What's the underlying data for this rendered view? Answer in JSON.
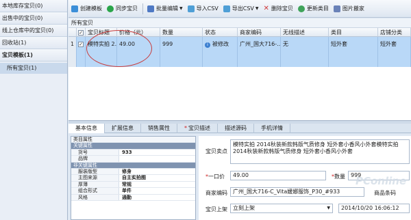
{
  "sidebar": {
    "items": [
      {
        "label": "本地库存宝贝(0)"
      },
      {
        "label": "出售中的宝贝(0)"
      },
      {
        "label": "线上仓库中的宝贝(0)"
      },
      {
        "label": "回收站(1)"
      },
      {
        "label": "宝贝模板(1)"
      }
    ],
    "sub_item": {
      "label": "所有宝贝(1)"
    }
  },
  "toolbar": {
    "buttons": [
      {
        "label": "创建模板",
        "icon": "create-icon",
        "color": "#3b8ed8"
      },
      {
        "label": "同步宝贝",
        "icon": "sync-icon",
        "color": "#2aa54a"
      },
      {
        "label": "批量编辑",
        "icon": "batch-edit-icon",
        "color": "#4f79c4"
      },
      {
        "label": "导入CSV",
        "icon": "import-icon",
        "color": "#4f9fd6"
      },
      {
        "label": "导出CSV",
        "icon": "export-icon",
        "color": "#4f9fd6"
      },
      {
        "label": "删除宝贝",
        "icon": "delete-icon",
        "color": "#d03a3a"
      },
      {
        "label": "更新类目",
        "icon": "refresh-icon",
        "color": "#3fa35a"
      },
      {
        "label": "图片搬家",
        "icon": "image-icon",
        "color": "#6a82b8"
      }
    ]
  },
  "grid": {
    "title": "所有宝贝",
    "columns": [
      "宝贝标题",
      "价格（元）",
      "数量",
      "状态",
      "商家编码",
      "无线描述",
      "类目",
      "店铺分类"
    ],
    "rows": [
      {
        "row_no": "1",
        "title": "模特实拍 2...",
        "price": "49.00",
        "qty": "999",
        "status": "被修改",
        "code": "广州_国大716-...",
        "wireless": "无",
        "category": "短外套",
        "shop_cat": "短外套"
      }
    ]
  },
  "tabs": [
    {
      "label": "基本信息",
      "active": true,
      "required": false
    },
    {
      "label": "扩展信息",
      "active": false,
      "required": false
    },
    {
      "label": "销售属性",
      "active": false,
      "required": false
    },
    {
      "label": "宝贝描述",
      "active": false,
      "required": true
    },
    {
      "label": "描述源码",
      "active": false,
      "required": false
    },
    {
      "label": "手机详情",
      "active": false,
      "required": false
    }
  ],
  "properties": {
    "title": "类目属性",
    "sections": [
      {
        "name": "关键属性",
        "rows": [
          {
            "k": "货号",
            "v": "933"
          },
          {
            "k": "品牌",
            "v": ""
          }
        ]
      },
      {
        "name": "非关键属性",
        "rows": [
          {
            "k": "服装版型",
            "v": "修身"
          },
          {
            "k": "主图来源",
            "v": "自主实拍图"
          },
          {
            "k": "厚薄",
            "v": "常规"
          },
          {
            "k": "组合形式",
            "v": "单件"
          },
          {
            "k": "风格",
            "v": "通勤"
          }
        ]
      }
    ]
  },
  "form": {
    "selling_point_label": "宝贝卖点",
    "selling_point_value": "模特实拍 2014秋装新款韩版气质修身 短外套小香风小外套模特实拍 2014秋装新款韩版气质修身 短外套小香风小外套",
    "price_label": "一口价",
    "price_value": "49.00",
    "qty_label": "数量",
    "qty_value": "999",
    "code_label": "商家编码",
    "code_value": "广州_国大716-C_Vita媛娜服饰_P30_#933",
    "barcode_label": "商品条码",
    "listing_label": "宝贝上架",
    "listing_value": "立刻上架",
    "listing_time": "2014/10/20 16:06:12"
  },
  "watermark": "PConline"
}
